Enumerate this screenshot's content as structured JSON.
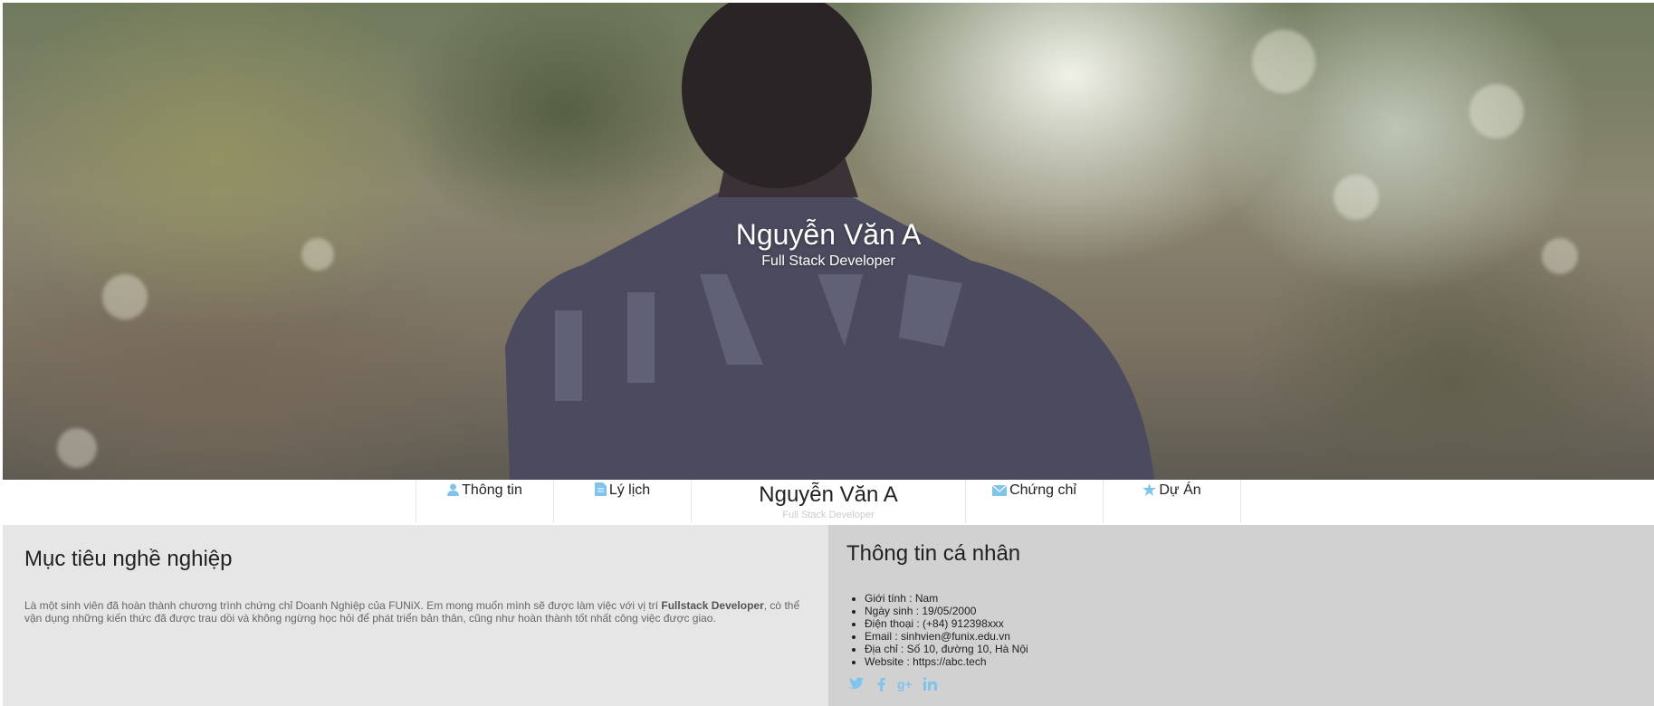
{
  "hero": {
    "name": "Nguyễn Văn A",
    "role": "Full Stack Developer"
  },
  "nav": {
    "items": [
      {
        "label": "Thông tin",
        "icon": "user-icon"
      },
      {
        "label": "Lý lịch",
        "icon": "document-icon"
      },
      {
        "label": "Chứng chỉ",
        "icon": "envelope-icon"
      },
      {
        "label": "Dự Án",
        "icon": "star-icon"
      }
    ],
    "brand_name": "Nguyễn Văn A",
    "brand_sub": "Full Stack Developer",
    "icon_color": "#7fc4ec"
  },
  "objective": {
    "title": "Mục tiêu nghề nghiệp",
    "text_before": "Là một sinh viên đã hoàn thành chương trình chứng chỉ Doanh Nghiệp của FUNiX. Em mong muốn mình sẽ được làm việc với vị trí ",
    "text_bold": "Fullstack Developer",
    "text_after": ", cò thể vận dụng những kiến thức đã được trau dồi và không ngừng học hỏi để phát triển bản thân, cũng như hoàn thành tốt nhất công việc được giao."
  },
  "personal": {
    "title": "Thông tin cá nhân",
    "items": [
      "Giới tính : Nam",
      "Ngày sinh : 19/05/2000",
      "Điện thoại : (+84) 912398xxx",
      "Email : sinhvien@funix.edu.vn",
      "Địa chỉ : Số 10, đường 10, Hà Nội",
      "Website : https://abc.tech"
    ],
    "socials": [
      "twitter-icon",
      "facebook-icon",
      "google-plus-icon",
      "linkedin-icon"
    ]
  },
  "colors": {
    "left_bg": "#e6e6e6",
    "right_bg": "#d1d1d1",
    "accent": "#7fc4ec"
  }
}
